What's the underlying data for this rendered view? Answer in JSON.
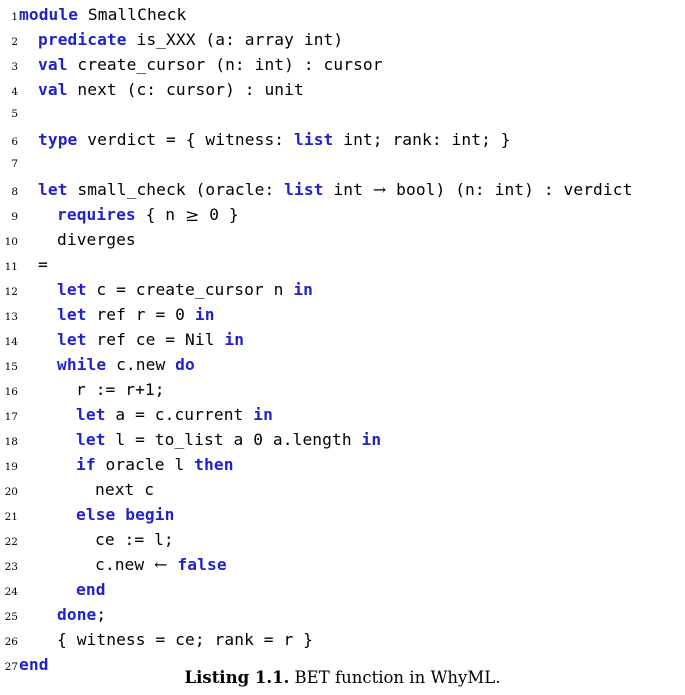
{
  "listing": {
    "language": "WhyML",
    "keyword_color": "#2222CC",
    "text_color": "#000000",
    "background_color": "#ffffff",
    "lines": [
      {
        "n": "1",
        "indent": 0,
        "tokens": [
          {
            "t": "module",
            "k": true
          },
          {
            "t": " SmallCheck",
            "k": false
          }
        ]
      },
      {
        "n": "2",
        "indent": 1,
        "tokens": [
          {
            "t": "predicate",
            "k": true
          },
          {
            "t": " is_XXX (a: array int)",
            "k": false
          }
        ]
      },
      {
        "n": "3",
        "indent": 1,
        "tokens": [
          {
            "t": "val",
            "k": true
          },
          {
            "t": " create_cursor (n: int) : cursor",
            "k": false
          }
        ]
      },
      {
        "n": "4",
        "indent": 1,
        "tokens": [
          {
            "t": "val",
            "k": true
          },
          {
            "t": " next (c: cursor) : unit",
            "k": false
          }
        ]
      },
      {
        "n": "5",
        "indent": 0,
        "tokens": []
      },
      {
        "n": "6",
        "indent": 1,
        "tokens": [
          {
            "t": "type",
            "k": true
          },
          {
            "t": " verdict = { witness: ",
            "k": false
          },
          {
            "t": "list",
            "k": true
          },
          {
            "t": " int; rank: int; }",
            "k": false
          }
        ]
      },
      {
        "n": "7",
        "indent": 0,
        "tokens": []
      },
      {
        "n": "8",
        "indent": 1,
        "tokens": [
          {
            "t": "let",
            "k": true
          },
          {
            "t": " small_check (oracle: ",
            "k": false
          },
          {
            "t": "list",
            "k": true
          },
          {
            "t": " int → bool) (n: int) : verdict",
            "k": false
          }
        ]
      },
      {
        "n": "9",
        "indent": 2,
        "tokens": [
          {
            "t": "requires",
            "k": true
          },
          {
            "t": " { n ≥ 0 }",
            "k": false
          }
        ]
      },
      {
        "n": "10",
        "indent": 2,
        "tokens": [
          {
            "t": "diverges",
            "k": false
          }
        ]
      },
      {
        "n": "11",
        "indent": 1,
        "tokens": [
          {
            "t": "=",
            "k": false
          }
        ]
      },
      {
        "n": "12",
        "indent": 2,
        "tokens": [
          {
            "t": "let",
            "k": true
          },
          {
            "t": " c = create_cursor n ",
            "k": false
          },
          {
            "t": "in",
            "k": true
          }
        ]
      },
      {
        "n": "13",
        "indent": 2,
        "tokens": [
          {
            "t": "let",
            "k": true
          },
          {
            "t": " ref r = 0 ",
            "k": false
          },
          {
            "t": "in",
            "k": true
          }
        ]
      },
      {
        "n": "14",
        "indent": 2,
        "tokens": [
          {
            "t": "let",
            "k": true
          },
          {
            "t": " ref ce = Nil ",
            "k": false
          },
          {
            "t": "in",
            "k": true
          }
        ]
      },
      {
        "n": "15",
        "indent": 2,
        "tokens": [
          {
            "t": "while",
            "k": true
          },
          {
            "t": " c.new ",
            "k": false
          },
          {
            "t": "do",
            "k": true
          }
        ]
      },
      {
        "n": "16",
        "indent": 3,
        "tokens": [
          {
            "t": "r := r+1;",
            "k": false
          }
        ]
      },
      {
        "n": "17",
        "indent": 3,
        "tokens": [
          {
            "t": "let",
            "k": true
          },
          {
            "t": " a = c.current ",
            "k": false
          },
          {
            "t": "in",
            "k": true
          }
        ]
      },
      {
        "n": "18",
        "indent": 3,
        "tokens": [
          {
            "t": "let",
            "k": true
          },
          {
            "t": " l = to_list a 0 a.length ",
            "k": false
          },
          {
            "t": "in",
            "k": true
          }
        ]
      },
      {
        "n": "19",
        "indent": 3,
        "tokens": [
          {
            "t": "if",
            "k": true
          },
          {
            "t": " oracle l ",
            "k": false
          },
          {
            "t": "then",
            "k": true
          }
        ]
      },
      {
        "n": "20",
        "indent": 4,
        "tokens": [
          {
            "t": "next c",
            "k": false
          }
        ]
      },
      {
        "n": "21",
        "indent": 3,
        "tokens": [
          {
            "t": "else begin",
            "k": true
          }
        ]
      },
      {
        "n": "22",
        "indent": 4,
        "tokens": [
          {
            "t": "ce := l;",
            "k": false
          }
        ]
      },
      {
        "n": "23",
        "indent": 4,
        "tokens": [
          {
            "t": "c.new ← ",
            "k": false
          },
          {
            "t": "false",
            "k": true
          }
        ]
      },
      {
        "n": "24",
        "indent": 3,
        "tokens": [
          {
            "t": "end",
            "k": true
          }
        ]
      },
      {
        "n": "25",
        "indent": 2,
        "tokens": [
          {
            "t": "done",
            "k": true
          },
          {
            "t": ";",
            "k": false
          }
        ]
      },
      {
        "n": "26",
        "indent": 2,
        "tokens": [
          {
            "t": "{ witness = ce; rank = r }",
            "k": false
          }
        ]
      },
      {
        "n": "27",
        "indent": 0,
        "tokens": [
          {
            "t": "end",
            "k": true
          }
        ]
      }
    ]
  },
  "caption": {
    "label": "Listing 1.1.",
    "text": " BET function in WhyML."
  }
}
